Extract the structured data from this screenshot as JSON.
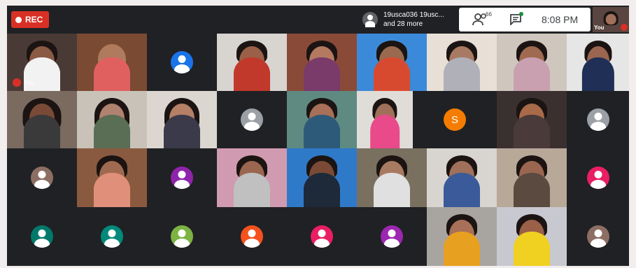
{
  "recording": {
    "label": "REC",
    "color": "#d93025"
  },
  "presenter": {
    "line1": "19usca036 19usc...",
    "line2": "and 28 more"
  },
  "toolbar": {
    "participant_count": "66",
    "time": "8:08 PM"
  },
  "self_view": {
    "label": "You"
  },
  "main_self_tile": {
    "label": "You"
  },
  "letter_avatar": {
    "letter": "S",
    "color": "#f57c00"
  },
  "avatar_colors": {
    "blue": "#1a73e8",
    "grey": "#9aa0a6",
    "brown": "#8d6e63",
    "purple": "#8e24aa",
    "pink": "#e91e63",
    "teal": "#00796b",
    "teal_light": "#00897b",
    "green": "#7cb342",
    "orange": "#f4511e",
    "violet": "#9c27b0"
  }
}
